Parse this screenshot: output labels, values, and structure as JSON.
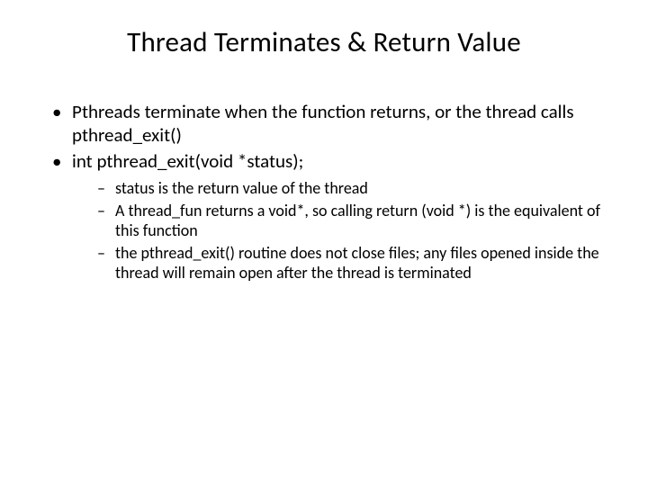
{
  "title": "Thread Terminates & Return Value",
  "bullets": [
    {
      "text": "Pthreads terminate when the function returns, or the thread calls pthread_exit()"
    },
    {
      "text": "int pthread_exit(void *status);",
      "sub": [
        "status is the return value of the thread",
        "A thread_fun returns a void*, so calling return (void *) is the equivalent of this function",
        "the pthread_exit() routine does not close files; any files opened inside the thread will remain open after the thread is terminated"
      ]
    }
  ]
}
